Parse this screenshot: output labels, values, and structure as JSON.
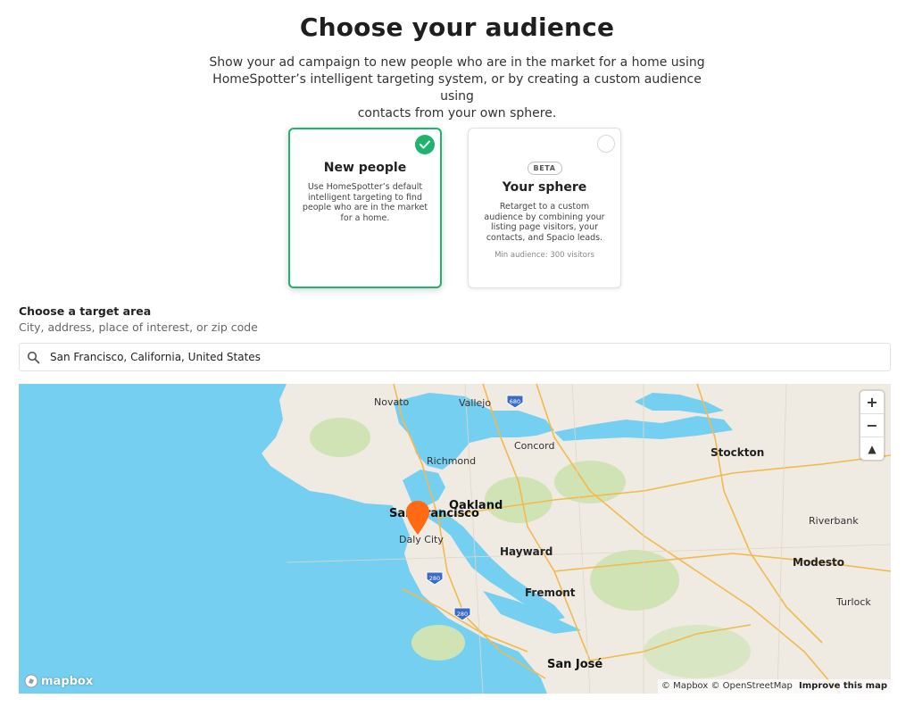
{
  "page": {
    "title": "Choose your audience",
    "intro_lines": [
      "Show your ad campaign to new people who are in the market for a home using",
      "HomeSpotter’s intelligent targeting system, or by creating a custom audience using",
      "contacts from your own sphere."
    ]
  },
  "cards": {
    "new_people": {
      "title": "New people",
      "description": "Use HomeSpotter’s default intelligent targeting to find people who are in the market for a home.",
      "selected": true
    },
    "your_sphere": {
      "badge": "BETA",
      "title": "Your sphere",
      "description": "Retarget to a custom audience by combining your listing page visitors, your contacts, and Spacio leads.",
      "note": "Min audience: 300 visitors",
      "selected": false
    }
  },
  "target_area": {
    "label": "Choose a target area",
    "sublabel": "City, address, place of interest, or zip code",
    "search_value": "San Francisco, California, United States"
  },
  "map": {
    "places": {
      "novato": "Novato",
      "vallejo": "Vallejo",
      "concord": "Concord",
      "richmond": "Richmond",
      "stockton": "Stockton",
      "oakland": "Oakland",
      "san_francisco": "San Francisco",
      "daly_city": "Daly City",
      "hayward": "Hayward",
      "riverbank": "Riverbank",
      "modesto": "Modesto",
      "fremont": "Fremont",
      "turlock": "Turlock",
      "san_jose": "San José"
    },
    "shields": [
      "680",
      "280",
      "280"
    ],
    "zoom_in": "+",
    "zoom_out": "−",
    "compass": "▲",
    "logo_text": "mapbox",
    "attribution": "© Mapbox © OpenStreetMap",
    "improve_link": "Improve this map"
  },
  "colors": {
    "accent_green": "#1fb36b",
    "pin_orange": "#ff6a13",
    "water": "#75cff0",
    "land": "#efeae2",
    "parks": "#cfe3b5",
    "roads": "#f3b94d"
  }
}
